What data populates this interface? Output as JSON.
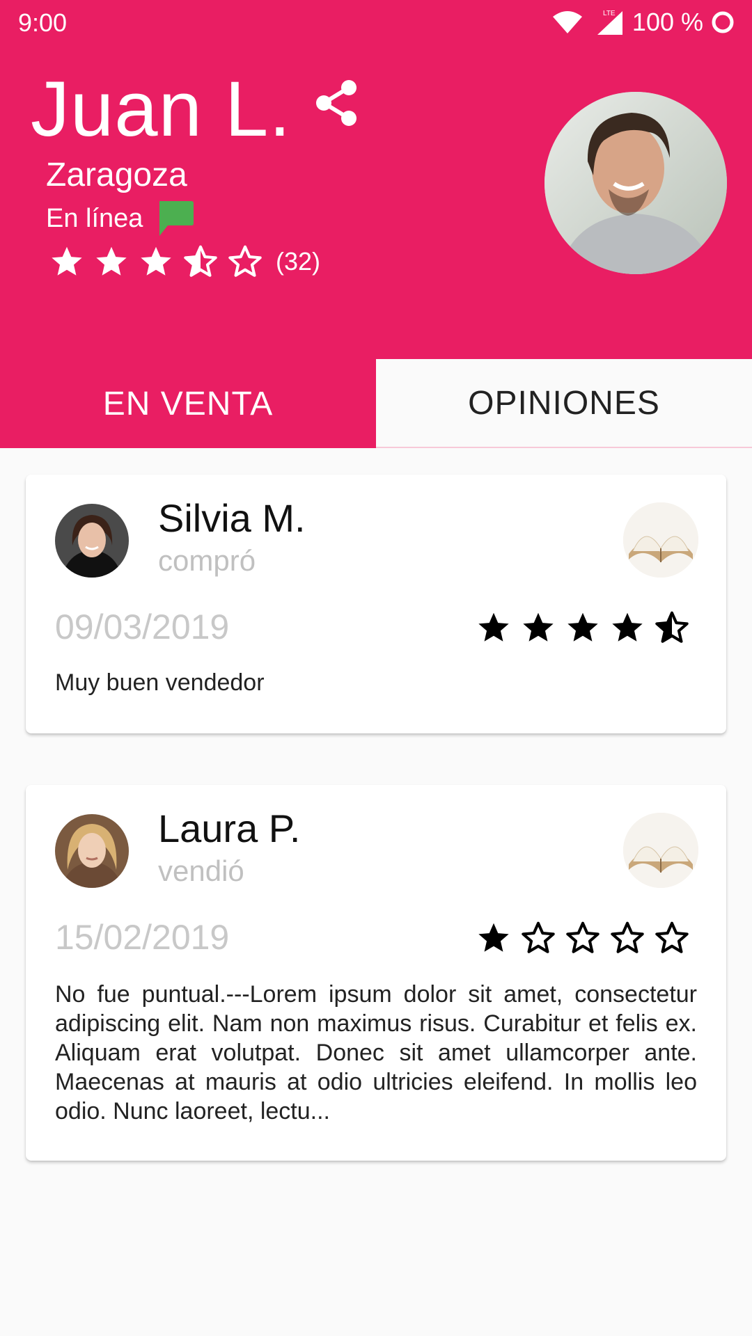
{
  "status_bar": {
    "time": "9:00",
    "battery": "100 %"
  },
  "profile": {
    "name": "Juan L.",
    "city": "Zaragoza",
    "status": "En línea",
    "rating": 3.5,
    "rating_count": "(32)"
  },
  "tabs": [
    {
      "label": "EN VENTA",
      "selected": false
    },
    {
      "label": "OPINIONES",
      "selected": true
    }
  ],
  "reviews": [
    {
      "name": "Silvia M.",
      "action": "compró",
      "date": "09/03/2019",
      "rating": 4.5,
      "text": "Muy buen vendedor"
    },
    {
      "name": "Laura P.",
      "action": "vendió",
      "date": "15/02/2019",
      "rating": 1,
      "text": "No fue puntual.---Lorem ipsum dolor sit amet, consectetur adipiscing elit. Nam non maximus risus. Curabitur et felis ex. Aliquam erat volutpat. Donec sit amet ullamcorper ante. Maecenas at mauris at odio ultricies eleifend. In mollis leo odio. Nunc laoreet, lectu..."
    }
  ],
  "colors": {
    "primary": "#e91e63",
    "online": "#4caf50",
    "muted": "#c0c0c0"
  },
  "icons": [
    "wifi-icon",
    "lte-signal-icon",
    "battery-ring-icon",
    "share-icon",
    "chat-icon",
    "star-icon",
    "half-star-icon",
    "empty-star-icon",
    "book-icon"
  ]
}
